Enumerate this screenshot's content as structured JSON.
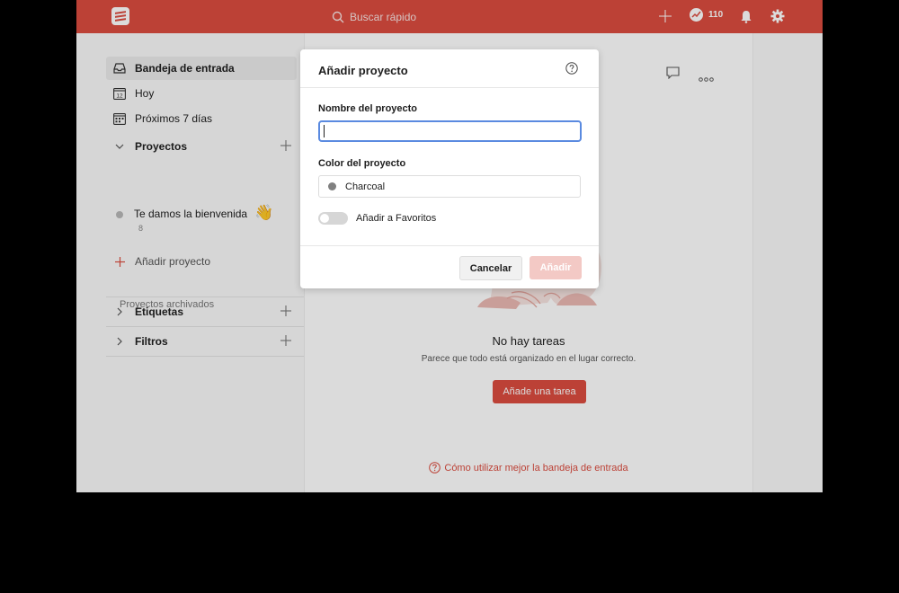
{
  "topbar": {
    "search_placeholder": "Buscar rápido",
    "karma_count": "110",
    "brand_color": "#db4c3f"
  },
  "sidebar": {
    "items": [
      {
        "label": "Bandeja de entrada",
        "icon": "inbox-icon",
        "active": true
      },
      {
        "label": "Hoy",
        "icon": "calendar-today-icon",
        "day": "12"
      },
      {
        "label": "Próximos 7 días",
        "icon": "calendar-week-icon"
      }
    ],
    "projects_label": "Proyectos",
    "project": {
      "name": "Te damos la bienvenida",
      "emoji": "👋",
      "count": "8"
    },
    "add_project_label": "Añadir proyecto",
    "archived_label": "Proyectos archivados",
    "labels_label": "Etiquetas",
    "filters_label": "Filtros"
  },
  "main": {
    "empty_title": "No hay tareas",
    "empty_subtitle": "Parece que todo está organizado en el lugar correcto.",
    "add_task_label": "Añade una tarea",
    "help_link": "Cómo utilizar mejor la bandeja de entrada"
  },
  "modal": {
    "title": "Añadir proyecto",
    "name_label": "Nombre del proyecto",
    "name_value": "",
    "color_label": "Color del proyecto",
    "color_value": "Charcoal",
    "color_hex": "#808080",
    "favorite_label": "Añadir a Favoritos",
    "favorite_on": false,
    "cancel_label": "Cancelar",
    "add_label": "Añadir"
  }
}
